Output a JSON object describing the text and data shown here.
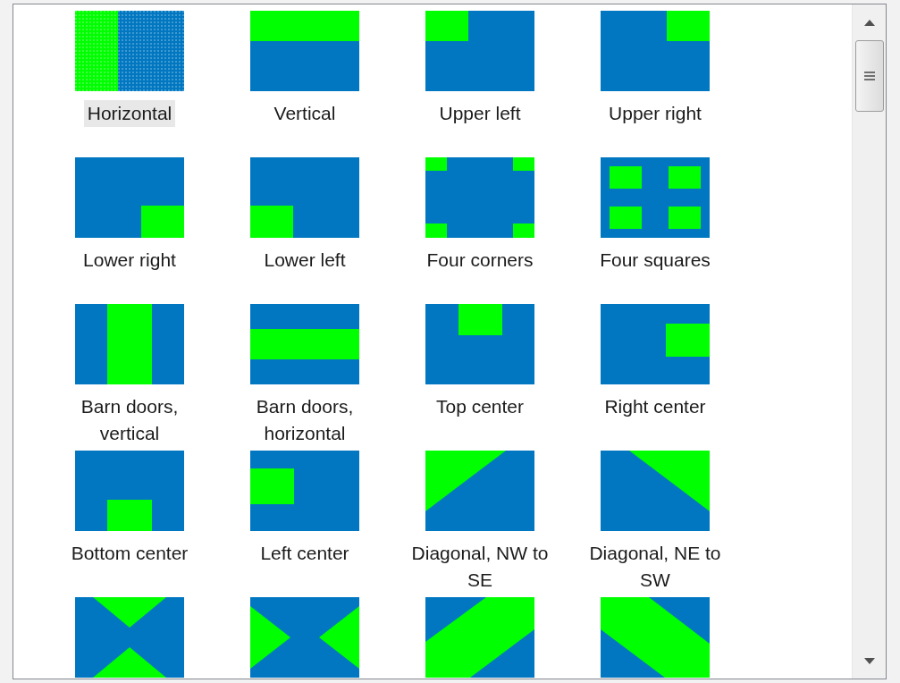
{
  "items": [
    {
      "kind": "horizontal",
      "label": "Horizontal",
      "selected": true
    },
    {
      "kind": "vertical",
      "label": "Vertical",
      "selected": false
    },
    {
      "kind": "upper-left",
      "label": "Upper left",
      "selected": false
    },
    {
      "kind": "upper-right",
      "label": "Upper right",
      "selected": false
    },
    {
      "kind": "lower-right",
      "label": "Lower right",
      "selected": false
    },
    {
      "kind": "lower-left",
      "label": "Lower left",
      "selected": false
    },
    {
      "kind": "four-corners",
      "label": "Four corners",
      "selected": false
    },
    {
      "kind": "four-squares",
      "label": "Four squares",
      "selected": false
    },
    {
      "kind": "barn-vertical",
      "label": "Barn doors, vertical",
      "selected": false
    },
    {
      "kind": "barn-horizontal",
      "label": "Barn doors, horizontal",
      "selected": false
    },
    {
      "kind": "top-center",
      "label": "Top center",
      "selected": false
    },
    {
      "kind": "right-center",
      "label": "Right center",
      "selected": false
    },
    {
      "kind": "bottom-center",
      "label": "Bottom center",
      "selected": false
    },
    {
      "kind": "left-center",
      "label": "Left center",
      "selected": false
    },
    {
      "kind": "diagonal-nw-se",
      "label": "Diagonal, NW to SE",
      "selected": false
    },
    {
      "kind": "diagonal-ne-sw",
      "label": "Diagonal, NE to SW",
      "selected": false
    },
    {
      "kind": "hourglass-vertical",
      "selected": false
    },
    {
      "kind": "hourglass-horizontal",
      "selected": false
    },
    {
      "kind": "band-up",
      "selected": false
    },
    {
      "kind": "band-down",
      "selected": false
    }
  ]
}
